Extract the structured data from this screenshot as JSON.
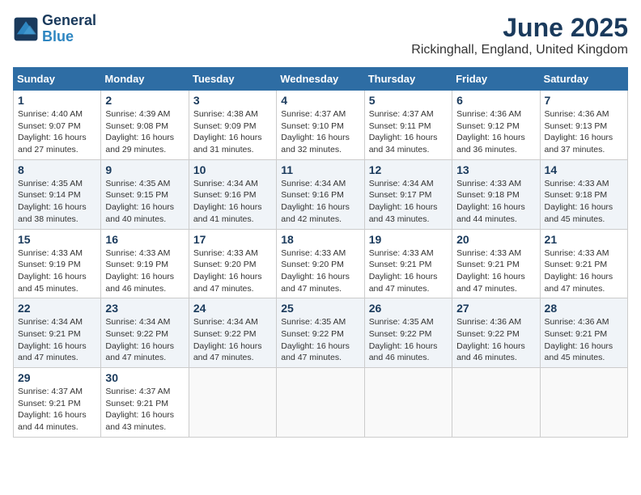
{
  "header": {
    "logo_line1": "General",
    "logo_line2": "Blue",
    "month_title": "June 2025",
    "location": "Rickinghall, England, United Kingdom"
  },
  "weekdays": [
    "Sunday",
    "Monday",
    "Tuesday",
    "Wednesday",
    "Thursday",
    "Friday",
    "Saturday"
  ],
  "weeks": [
    [
      {
        "day": "1",
        "sunrise": "4:40 AM",
        "sunset": "9:07 PM",
        "daylight": "16 hours and 27 minutes."
      },
      {
        "day": "2",
        "sunrise": "4:39 AM",
        "sunset": "9:08 PM",
        "daylight": "16 hours and 29 minutes."
      },
      {
        "day": "3",
        "sunrise": "4:38 AM",
        "sunset": "9:09 PM",
        "daylight": "16 hours and 31 minutes."
      },
      {
        "day": "4",
        "sunrise": "4:37 AM",
        "sunset": "9:10 PM",
        "daylight": "16 hours and 32 minutes."
      },
      {
        "day": "5",
        "sunrise": "4:37 AM",
        "sunset": "9:11 PM",
        "daylight": "16 hours and 34 minutes."
      },
      {
        "day": "6",
        "sunrise": "4:36 AM",
        "sunset": "9:12 PM",
        "daylight": "16 hours and 36 minutes."
      },
      {
        "day": "7",
        "sunrise": "4:36 AM",
        "sunset": "9:13 PM",
        "daylight": "16 hours and 37 minutes."
      }
    ],
    [
      {
        "day": "8",
        "sunrise": "4:35 AM",
        "sunset": "9:14 PM",
        "daylight": "16 hours and 38 minutes."
      },
      {
        "day": "9",
        "sunrise": "4:35 AM",
        "sunset": "9:15 PM",
        "daylight": "16 hours and 40 minutes."
      },
      {
        "day": "10",
        "sunrise": "4:34 AM",
        "sunset": "9:16 PM",
        "daylight": "16 hours and 41 minutes."
      },
      {
        "day": "11",
        "sunrise": "4:34 AM",
        "sunset": "9:16 PM",
        "daylight": "16 hours and 42 minutes."
      },
      {
        "day": "12",
        "sunrise": "4:34 AM",
        "sunset": "9:17 PM",
        "daylight": "16 hours and 43 minutes."
      },
      {
        "day": "13",
        "sunrise": "4:33 AM",
        "sunset": "9:18 PM",
        "daylight": "16 hours and 44 minutes."
      },
      {
        "day": "14",
        "sunrise": "4:33 AM",
        "sunset": "9:18 PM",
        "daylight": "16 hours and 45 minutes."
      }
    ],
    [
      {
        "day": "15",
        "sunrise": "4:33 AM",
        "sunset": "9:19 PM",
        "daylight": "16 hours and 45 minutes."
      },
      {
        "day": "16",
        "sunrise": "4:33 AM",
        "sunset": "9:19 PM",
        "daylight": "16 hours and 46 minutes."
      },
      {
        "day": "17",
        "sunrise": "4:33 AM",
        "sunset": "9:20 PM",
        "daylight": "16 hours and 47 minutes."
      },
      {
        "day": "18",
        "sunrise": "4:33 AM",
        "sunset": "9:20 PM",
        "daylight": "16 hours and 47 minutes."
      },
      {
        "day": "19",
        "sunrise": "4:33 AM",
        "sunset": "9:21 PM",
        "daylight": "16 hours and 47 minutes."
      },
      {
        "day": "20",
        "sunrise": "4:33 AM",
        "sunset": "9:21 PM",
        "daylight": "16 hours and 47 minutes."
      },
      {
        "day": "21",
        "sunrise": "4:33 AM",
        "sunset": "9:21 PM",
        "daylight": "16 hours and 47 minutes."
      }
    ],
    [
      {
        "day": "22",
        "sunrise": "4:34 AM",
        "sunset": "9:21 PM",
        "daylight": "16 hours and 47 minutes."
      },
      {
        "day": "23",
        "sunrise": "4:34 AM",
        "sunset": "9:22 PM",
        "daylight": "16 hours and 47 minutes."
      },
      {
        "day": "24",
        "sunrise": "4:34 AM",
        "sunset": "9:22 PM",
        "daylight": "16 hours and 47 minutes."
      },
      {
        "day": "25",
        "sunrise": "4:35 AM",
        "sunset": "9:22 PM",
        "daylight": "16 hours and 47 minutes."
      },
      {
        "day": "26",
        "sunrise": "4:35 AM",
        "sunset": "9:22 PM",
        "daylight": "16 hours and 46 minutes."
      },
      {
        "day": "27",
        "sunrise": "4:36 AM",
        "sunset": "9:22 PM",
        "daylight": "16 hours and 46 minutes."
      },
      {
        "day": "28",
        "sunrise": "4:36 AM",
        "sunset": "9:21 PM",
        "daylight": "16 hours and 45 minutes."
      }
    ],
    [
      {
        "day": "29",
        "sunrise": "4:37 AM",
        "sunset": "9:21 PM",
        "daylight": "16 hours and 44 minutes."
      },
      {
        "day": "30",
        "sunrise": "4:37 AM",
        "sunset": "9:21 PM",
        "daylight": "16 hours and 43 minutes."
      },
      null,
      null,
      null,
      null,
      null
    ]
  ]
}
